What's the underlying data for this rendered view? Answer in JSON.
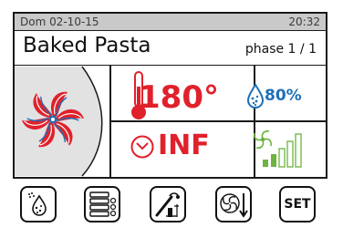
{
  "status": {
    "date": "Dom 02-10-15",
    "time": "20:32"
  },
  "program": {
    "name": "Baked Pasta",
    "phase": "phase 1 / 1"
  },
  "cooking": {
    "temperature": "180°",
    "humidity": "80%",
    "time": "INF",
    "fan_speed_level": 2,
    "fan_speed_max": 5
  },
  "icons": {
    "fan": "fan-icon",
    "thermometer": "thermometer-icon",
    "humidity": "droplet-icon",
    "timer": "timer-icon",
    "fan_speed": "fan-speed-icon"
  },
  "buttons": [
    {
      "name": "humidity-button",
      "icon": "humidity-steam-icon"
    },
    {
      "name": "trays-button",
      "icon": "trays-icon"
    },
    {
      "name": "probe-button",
      "icon": "core-probe-icon"
    },
    {
      "name": "fan-settings-button",
      "icon": "fan-down-icon"
    },
    {
      "name": "set-button",
      "label": "SET"
    }
  ],
  "colors": {
    "accent_red": "#e0212b",
    "accent_blue": "#1d6fb8",
    "accent_green": "#6cb33f",
    "statusbar_bg": "#c9c9c9"
  }
}
